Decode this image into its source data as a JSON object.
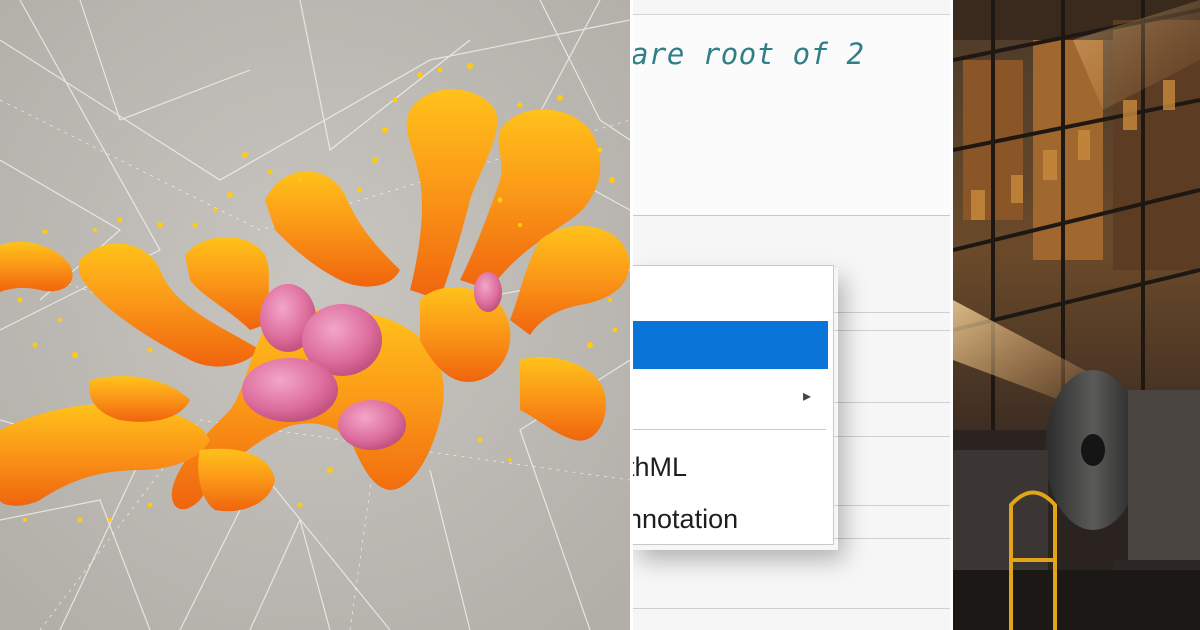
{
  "editor": {
    "comment_fragment": "are root of 2"
  },
  "context_menu": {
    "submenu_indicator": "submenu-arrow-icon",
    "items": [
      {
        "label": "thML"
      },
      {
        "label": "nnotation"
      }
    ]
  },
  "colors": {
    "highlight": "#0a74d8",
    "comment": "#2f7f87",
    "blob_orange": "#f4931c",
    "blob_pink": "#e07aa6"
  }
}
